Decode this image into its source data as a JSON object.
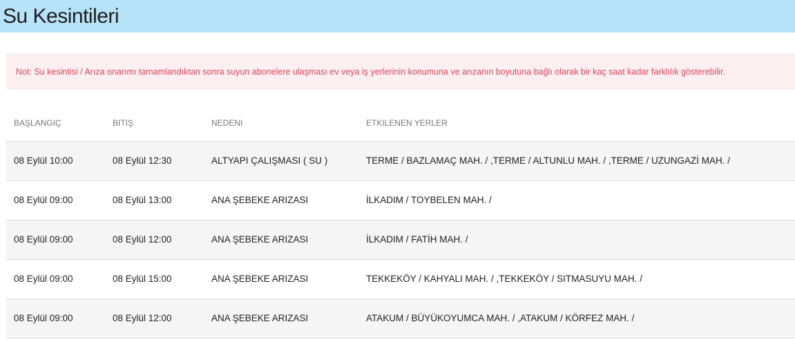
{
  "header": {
    "title": "Su Kesintileri"
  },
  "notice": {
    "text": "Not: Su kesintisi / Arıza onarımı tamamlandıktan sonra suyun abonelere ulaşması ev veya iş yerlerinin konumuna ve arızanın boyutuna bağlı olarak bir kaç saat kadar farklılık gösterebilir."
  },
  "table": {
    "columns": [
      "BAŞLANGIÇ",
      "BITIŞ",
      "NEDENI",
      "ETKILENEN YERLER"
    ],
    "rows": [
      [
        "08 Eylül 10:00",
        "08 Eylül 12:30",
        "ALTYAPI ÇALIŞMASI ( SU )",
        "TERME / BAZLAMAÇ MAH. / ,TERME / ALTUNLU MAH. / ,TERME / UZUNGAZİ MAH. /"
      ],
      [
        "08 Eylül 09:00",
        "08 Eylül 13:00",
        "ANA ŞEBEKE ARIZASI",
        "İLKADIM / TOYBELEN MAH. /"
      ],
      [
        "08 Eylül 09:00",
        "08 Eylül 12:00",
        "ANA ŞEBEKE ARIZASI",
        "İLKADIM / FATİH MAH. /"
      ],
      [
        "08 Eylül 09:00",
        "08 Eylül 15:00",
        "ANA ŞEBEKE ARIZASI",
        "TEKKEKÖY / KAHYALI MAH. / ,TEKKEKÖY / SITMASUYU MAH. /"
      ],
      [
        "08 Eylül 09:00",
        "08 Eylül 12:00",
        "ANA ŞEBEKE ARIZASI",
        "ATAKUM / BÜYÜKOYUMCA MAH. / ,ATAKUM / KÖRFEZ MAH. /"
      ]
    ]
  }
}
